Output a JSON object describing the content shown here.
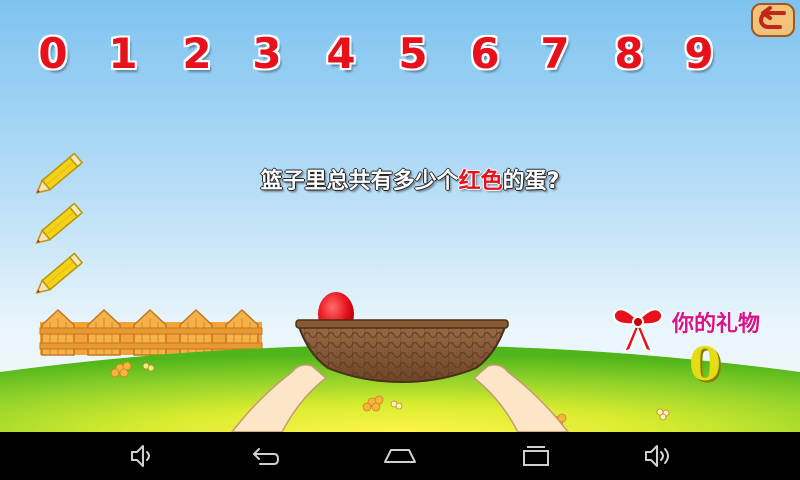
{
  "number_buttons": [
    "0",
    "1",
    "2",
    "3",
    "4",
    "5",
    "6",
    "7",
    "8",
    "9"
  ],
  "question": {
    "before": "篮子里总共有多少个",
    "highlight": "红色",
    "after": "的蛋?"
  },
  "gift": {
    "label": "你的礼物",
    "count": "0"
  },
  "tries_remaining": 3,
  "eggs_in_basket": [
    {
      "color": "red"
    }
  ],
  "icons": {
    "back": "back-arrow-icon",
    "life": "pencil-icon",
    "gift": "ribbon-bow-icon",
    "nav": [
      "volume-down-icon",
      "back-icon",
      "home-icon",
      "recent-apps-icon",
      "volume-up-icon"
    ]
  },
  "colors": {
    "number": "#e8101a",
    "highlight": "#e8101a",
    "gift_label": "#d8128a",
    "gift_count": "#e6dc14",
    "egg": "#e8101a"
  }
}
